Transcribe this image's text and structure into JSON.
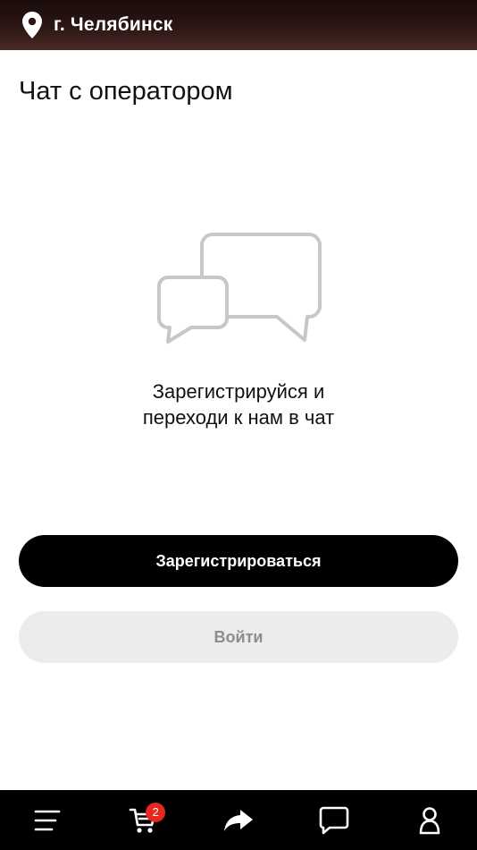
{
  "header": {
    "city": "г. Челябинск",
    "icon": "location-pin-icon"
  },
  "main": {
    "title": "Чат с оператором",
    "illustration_icon": "chat-bubbles-icon",
    "message_line1": "Зарегистрируйся и",
    "message_line2": "переходи к нам в чат",
    "register_label": "Зарегистрироваться",
    "login_label": "Войти"
  },
  "bottom_nav": {
    "items": [
      {
        "name": "menu",
        "icon": "menu-icon"
      },
      {
        "name": "cart",
        "icon": "cart-icon",
        "badge": "2"
      },
      {
        "name": "share",
        "icon": "share-icon"
      },
      {
        "name": "chat",
        "icon": "chat-icon"
      },
      {
        "name": "profile",
        "icon": "profile-icon"
      }
    ]
  },
  "colors": {
    "header_bg": "#2c1614",
    "primary_button": "#000000",
    "secondary_button": "#edebeb",
    "secondary_text": "#8e8c8c",
    "badge": "#e8281e",
    "nav_bg": "#000000"
  }
}
